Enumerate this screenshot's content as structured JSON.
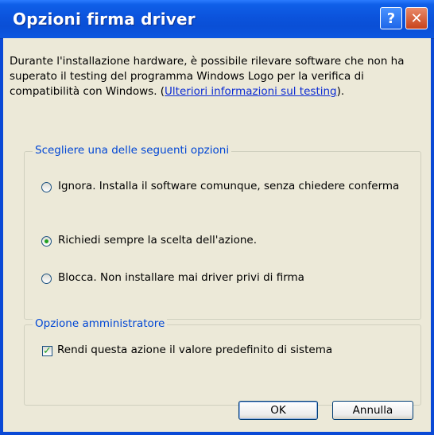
{
  "window": {
    "title": "Opzioni firma driver"
  },
  "titlebar": {
    "help_glyph": "?",
    "close_glyph": "✕"
  },
  "description": {
    "text": "Durante l'installazione hardware, è possibile rilevare software che non ha superato il testing del programma Windows Logo per la verifica di compatibilità con Windows. (",
    "link": "Ulteriori informazioni sul testing",
    "suffix": ")."
  },
  "options_group": {
    "label": "Scegliere una delle seguenti opzioni",
    "selected_index": 1,
    "options": [
      {
        "label": "Ignora. Installa il software comunque, senza chiedere conferma"
      },
      {
        "label": "Richiedi sempre la scelta dell'azione."
      },
      {
        "label": "Blocca. Non installare mai driver privi di firma"
      }
    ]
  },
  "admin_group": {
    "label": "Opzione amministratore",
    "checkbox_label": "Rendi questa azione il valore predefinito di sistema",
    "checked": true
  },
  "buttons": {
    "ok": "OK",
    "cancel": "Annulla"
  },
  "colors": {
    "titlebar": "#0a4fd6",
    "client_bg": "#ece9d8",
    "group_label": "#0046d5",
    "link": "#0b2bd3",
    "check": "#21a121"
  }
}
